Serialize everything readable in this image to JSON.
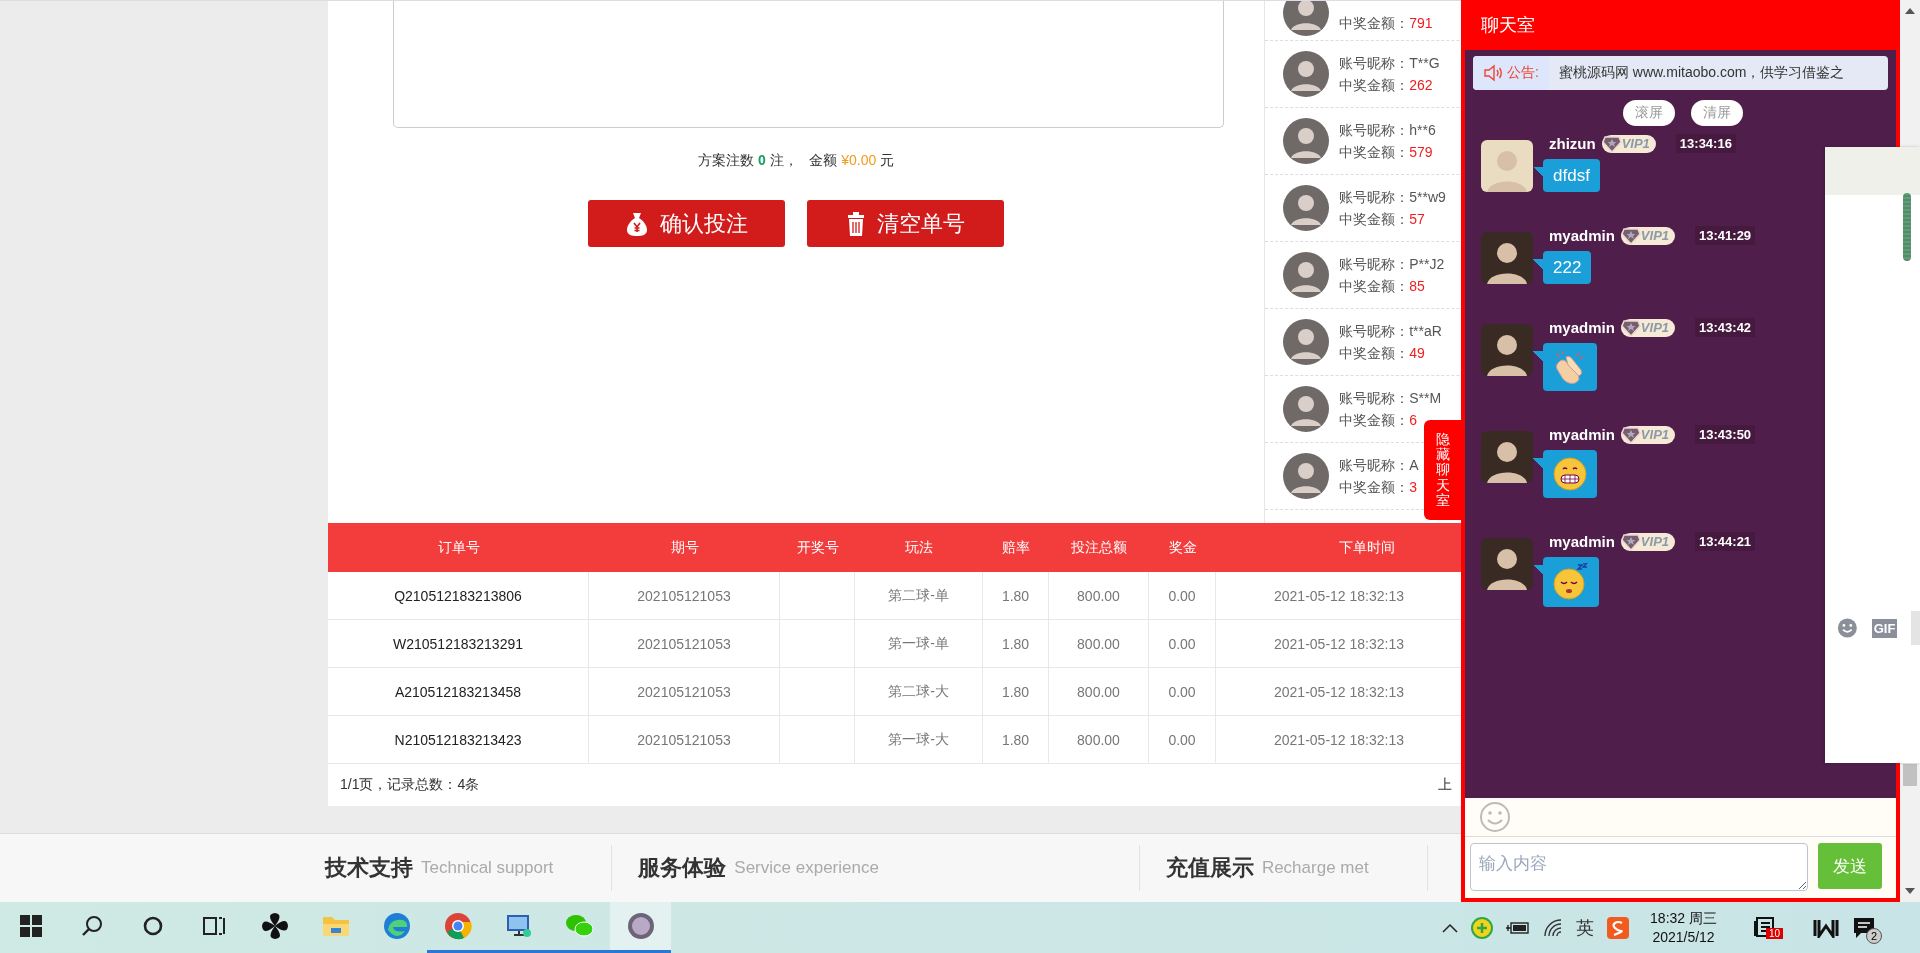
{
  "bet": {
    "summary": {
      "count_label": "方案注数",
      "count": "0",
      "count_unit": "注，",
      "amount_label": "金额",
      "amount": "¥0.00",
      "amount_unit": "元"
    },
    "actions": [
      {
        "kind": "confirm",
        "label": "确认投注"
      },
      {
        "kind": "clear",
        "label": "清空单号"
      }
    ]
  },
  "winners": [
    {
      "amount_label": "中奖金额：",
      "amount": "791"
    },
    {
      "name_label": "账号昵称：",
      "name": "T**G",
      "amount_label": "中奖金额：",
      "amount": "262"
    },
    {
      "name_label": "账号昵称：",
      "name": "h**6",
      "amount_label": "中奖金额：",
      "amount": "579"
    },
    {
      "name_label": "账号昵称：",
      "name": "5**w9",
      "amount_label": "中奖金额：",
      "amount": "57"
    },
    {
      "name_label": "账号昵称：",
      "name": "P**J2",
      "amount_label": "中奖金额：",
      "amount": "85"
    },
    {
      "name_label": "账号昵称：",
      "name": "t**aR",
      "amount_label": "中奖金额：",
      "amount": "49"
    },
    {
      "name_label": "账号昵称：",
      "name": "S**M",
      "amount_label": "中奖金额：",
      "amount": "6"
    },
    {
      "name_label": "账号昵称：",
      "name": "A",
      "amount_label": "中奖金额：",
      "amount": "3"
    }
  ],
  "orders": {
    "columns": [
      "订单号",
      "期号",
      "开奖号",
      "玩法",
      "赔率",
      "投注总额",
      "奖金",
      "下单时间"
    ],
    "rows": [
      {
        "order_no": "Q210512183213806",
        "issue": "202105121053",
        "play": "第二球-单",
        "odds": "1.80",
        "stake": "800.00",
        "bonus": "0.00",
        "time": "2021-05-12 18:32:13"
      },
      {
        "order_no": "W210512183213291",
        "issue": "202105121053",
        "play": "第一球-单",
        "odds": "1.80",
        "stake": "800.00",
        "bonus": "0.00",
        "time": "2021-05-12 18:32:13"
      },
      {
        "order_no": "A210512183213458",
        "issue": "202105121053",
        "play": "第二球-大",
        "odds": "1.80",
        "stake": "800.00",
        "bonus": "0.00",
        "time": "2021-05-12 18:32:13"
      },
      {
        "order_no": "N210512183213423",
        "issue": "202105121053",
        "play": "第一球-大",
        "odds": "1.80",
        "stake": "800.00",
        "bonus": "0.00",
        "time": "2021-05-12 18:32:13"
      }
    ]
  },
  "pagination": {
    "summary": "1/1页，记录总数：4条",
    "prev": "上"
  },
  "footer": [
    {
      "title": "技术支持",
      "subtitle": "Technical support"
    },
    {
      "title": "服务体验",
      "subtitle": "Service experience"
    },
    {
      "title": "充值展示",
      "subtitle": "Recharge met"
    }
  ],
  "chat": {
    "title": "聊天室",
    "notice_label": "公告:",
    "notice": "蜜桃源码网 www.mitaobo.com，供学习借鉴之",
    "buttons": [
      "滚屏",
      "清屏"
    ],
    "messages": [
      {
        "user": "zhizun",
        "badge": "VIP1",
        "time": "13:34:16",
        "kind": "text",
        "text": "dfdsf"
      },
      {
        "user": "myadmin",
        "badge": "VIP1",
        "time": "13:41:29",
        "kind": "text",
        "text": "222"
      },
      {
        "user": "myadmin",
        "badge": "VIP1",
        "time": "13:43:42",
        "kind": "clap"
      },
      {
        "user": "myadmin",
        "badge": "VIP1",
        "time": "13:43:50",
        "kind": "grin"
      },
      {
        "user": "myadmin",
        "badge": "VIP1",
        "time": "13:44:21",
        "kind": "sleepy"
      }
    ],
    "hide_button": "隐藏聊天室",
    "input": {
      "placeholder": "输入内容"
    },
    "send": "发送",
    "gif_label": "GIF"
  },
  "taskbar": {
    "apps": [
      {
        "kind": "start",
        "running": false,
        "selected": false
      },
      {
        "kind": "search",
        "running": false,
        "selected": false
      },
      {
        "kind": "cortana",
        "running": false,
        "selected": false
      },
      {
        "kind": "taskview",
        "running": false,
        "selected": false
      },
      {
        "kind": "pinwheel",
        "running": false,
        "selected": false
      },
      {
        "kind": "folder",
        "running": false,
        "selected": false
      },
      {
        "kind": "edge",
        "running": false,
        "selected": false
      },
      {
        "kind": "chrome",
        "running": true,
        "selected": false
      },
      {
        "kind": "remote",
        "running": true,
        "selected": false
      },
      {
        "kind": "wechat",
        "running": true,
        "selected": false
      },
      {
        "kind": "round",
        "running": true,
        "selected": true
      }
    ],
    "tray": {
      "ime": "英",
      "time": "18:32 周三",
      "date": "2021/5/12",
      "notification_badge": "10",
      "message_badge": "2"
    }
  }
}
